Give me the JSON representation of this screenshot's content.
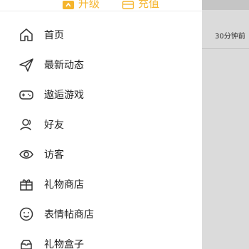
{
  "drawer": {
    "top_actions": [
      {
        "label": "升级",
        "icon": "upgrade-icon"
      },
      {
        "label": "充值",
        "icon": "wallet-icon"
      }
    ],
    "menu": [
      {
        "label": "首页",
        "icon": "home-icon"
      },
      {
        "label": "最新动态",
        "icon": "send-icon"
      },
      {
        "label": "遨逅游戏",
        "icon": "gamepad-icon"
      },
      {
        "label": "好友",
        "icon": "friends-icon"
      },
      {
        "label": "访客",
        "icon": "eye-icon"
      },
      {
        "label": "礼物商店",
        "icon": "gift-icon"
      },
      {
        "label": "表情帖商店",
        "icon": "emoji-icon"
      },
      {
        "label": "礼物盒子",
        "icon": "giftbox-icon"
      }
    ]
  },
  "background": {
    "timestamp": "30分钟前"
  },
  "colors": {
    "accent": "#f5b52e",
    "text": "#222222",
    "icon": "#333333"
  }
}
